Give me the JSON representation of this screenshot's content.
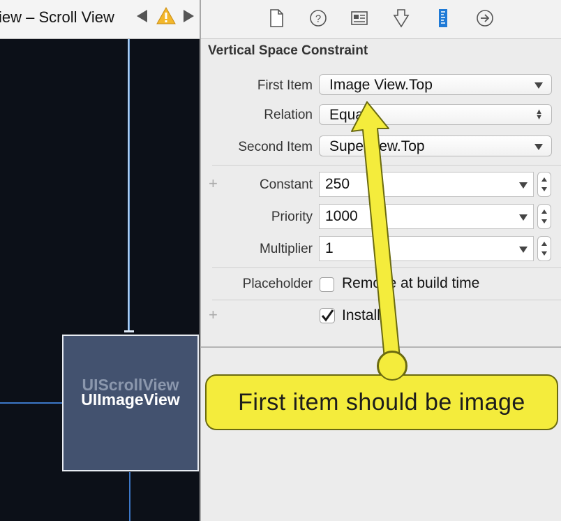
{
  "jump_bar": {
    "title": "iew – Scroll View"
  },
  "toolbar": {
    "icons": [
      "file-icon",
      "help-icon",
      "identity-icon",
      "attributes-icon",
      "size-ruler-icon",
      "connections-icon"
    ]
  },
  "canvas": {
    "scroll_view_label": "UIScrollView",
    "image_view_label": "UIImageView"
  },
  "inspector": {
    "section_title": "Vertical Space Constraint",
    "first_item": {
      "label": "First Item",
      "value": "Image View.Top"
    },
    "relation": {
      "label": "Relation",
      "value": "Equal"
    },
    "second_item": {
      "label": "Second Item",
      "value": "Superview.Top"
    },
    "constant": {
      "label": "Constant",
      "value": "250"
    },
    "priority": {
      "label": "Priority",
      "value": "1000"
    },
    "multiplier": {
      "label": "Multiplier",
      "value": "1"
    },
    "placeholder": {
      "label": "Placeholder",
      "checkbox_text": "Remove at build time",
      "checked": false
    },
    "installed": {
      "checkbox_text": "Installed",
      "checked": true
    },
    "add_symbol": "+"
  },
  "callout": {
    "text": "First item should be image"
  },
  "colors": {
    "callout": "#f4ec3c",
    "canvas": "#0c1018",
    "image_view": "#43526f",
    "selected_tool": "#1f7ad6"
  }
}
